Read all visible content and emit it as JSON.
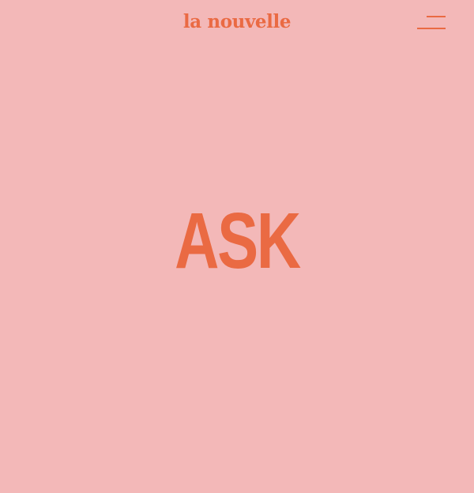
{
  "header": {
    "logo_text": "la nouvelle",
    "menu_icon": "hamburger-menu-icon"
  },
  "hero": {
    "word": "ASK"
  },
  "colors": {
    "background": "#f3b8b8",
    "accent": "#ea6a43"
  }
}
